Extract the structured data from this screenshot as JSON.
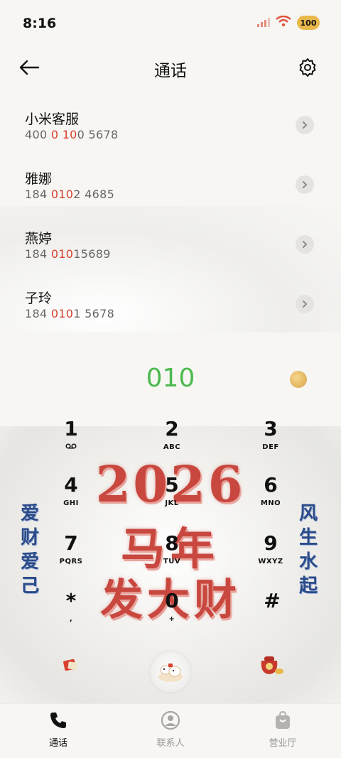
{
  "status": {
    "time": "8:16",
    "battery": "100"
  },
  "header": {
    "title": "通话"
  },
  "contacts": [
    {
      "name": "小米客服",
      "num_pre": "400 ",
      "num_hl1": "0",
      "num_mid": " ",
      "num_hl2": "10",
      "num_post": "0 5678"
    },
    {
      "name": "雅娜",
      "num_pre": "184 ",
      "num_hl1": "010",
      "num_mid": "",
      "num_hl2": "",
      "num_post": "2 4685"
    },
    {
      "name": "燕婷",
      "num_pre": "184 ",
      "num_hl1": "010",
      "num_mid": "",
      "num_hl2": "",
      "num_post": "15689"
    },
    {
      "name": "子玲",
      "num_pre": "184 ",
      "num_hl1": "010",
      "num_mid": "",
      "num_hl2": "",
      "num_post": "1 5678"
    }
  ],
  "dialer": {
    "input": "010",
    "keys": [
      {
        "digit": "1",
        "letters": ""
      },
      {
        "digit": "2",
        "letters": "ABC"
      },
      {
        "digit": "3",
        "letters": "DEF"
      },
      {
        "digit": "4",
        "letters": "GHI"
      },
      {
        "digit": "5",
        "letters": "JKL"
      },
      {
        "digit": "6",
        "letters": "MNO"
      },
      {
        "digit": "7",
        "letters": "PQRS"
      },
      {
        "digit": "8",
        "letters": "TUV"
      },
      {
        "digit": "9",
        "letters": "WXYZ"
      },
      {
        "digit": "*",
        "letters": ","
      },
      {
        "digit": "0",
        "letters": "+"
      },
      {
        "digit": "#",
        "letters": ""
      }
    ]
  },
  "artwork": {
    "year": "2026",
    "line2": "马年",
    "line3": "发大财",
    "couplet_left": "爱财爱己",
    "couplet_right": "风生水起"
  },
  "tabs": [
    {
      "label": "通话",
      "icon": "phone-icon",
      "active": true
    },
    {
      "label": "联系人",
      "icon": "contacts-icon",
      "active": false
    },
    {
      "label": "营业厅",
      "icon": "store-icon",
      "active": false
    }
  ],
  "colors": {
    "accent_green": "#4cba4e",
    "highlight_red": "#d8402d",
    "art_red": "#c8473e",
    "couplet_blue": "#2b4b8a"
  }
}
